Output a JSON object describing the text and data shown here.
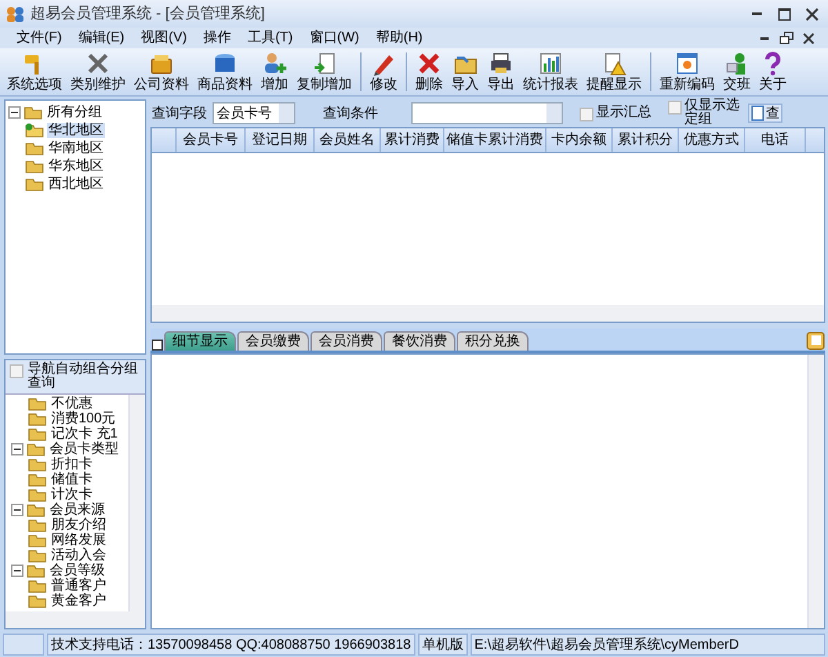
{
  "window": {
    "title": "超易会员管理系统 - [会员管理系统]"
  },
  "menu": [
    "文件(F)",
    "编辑(E)",
    "视图(V)",
    "操作",
    "工具(T)",
    "窗口(W)",
    "帮助(H)"
  ],
  "toolbar_groups": [
    {
      "buttons": [
        "系统选项",
        "类别维护",
        "公司资料",
        "商品资料",
        "增加",
        "复制增加"
      ]
    },
    {
      "buttons": [
        "修改"
      ]
    },
    {
      "buttons": [
        "删除",
        "导入",
        "导出",
        "统计报表",
        "提醒显示"
      ]
    },
    {
      "buttons": [
        "重新编码",
        "交班",
        "关于"
      ]
    }
  ],
  "group_tree": [
    {
      "label": "所有分组",
      "expanded": true,
      "selected": false,
      "children": [
        {
          "label": "华北地区",
          "selected": true
        },
        {
          "label": "华南地区",
          "selected": false
        },
        {
          "label": "华东地区",
          "selected": false
        },
        {
          "label": "西北地区",
          "selected": false
        }
      ]
    }
  ],
  "nav_panel": {
    "label": "导航自动组合分组查询",
    "checked": false,
    "tree": [
      {
        "label": "不优惠"
      },
      {
        "label": "消费100元"
      },
      {
        "label": "记次卡 充1"
      },
      {
        "label": "会员卡类型",
        "expanded": true,
        "children": [
          {
            "label": "折扣卡"
          },
          {
            "label": "储值卡"
          },
          {
            "label": "计次卡"
          }
        ]
      },
      {
        "label": "会员来源",
        "expanded": true,
        "children": [
          {
            "label": "朋友介绍"
          },
          {
            "label": "网络发展"
          },
          {
            "label": "活动入会"
          }
        ]
      },
      {
        "label": "会员等级",
        "expanded": true,
        "children": [
          {
            "label": "普通客户"
          },
          {
            "label": "黄金客户"
          }
        ]
      }
    ]
  },
  "query": {
    "field_label": "查询字段",
    "field_value": "会员卡号",
    "condition_label": "查询条件",
    "options": [
      {
        "label": "显示汇总",
        "checked": false
      },
      {
        "label": "仅显示选定组",
        "checked": false
      }
    ],
    "search_button": "查"
  },
  "table": {
    "columns": [
      "会员卡号",
      "登记日期",
      "会员姓名",
      "累计消费",
      "储值卡累计消费",
      "卡内余额",
      "累计积分",
      "优惠方式",
      "电话"
    ]
  },
  "tabs": [
    {
      "label": "细节显示",
      "selected": true
    },
    {
      "label": "会员缴费",
      "selected": false
    },
    {
      "label": "会员消费",
      "selected": false
    },
    {
      "label": "餐饮消费",
      "selected": false
    },
    {
      "label": "积分兑换",
      "selected": false
    }
  ],
  "status_bar": [
    "技术支持电话：13570098458 QQ:408088750 1966903818",
    "单机版",
    "E:\\超易软件\\超易会员管理系统\\cyMemberD"
  ]
}
